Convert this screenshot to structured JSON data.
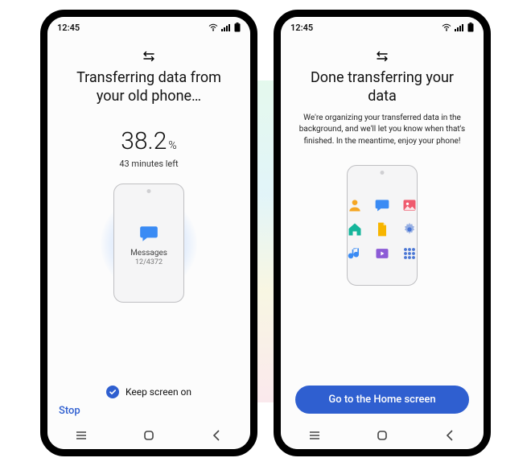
{
  "status": {
    "time": "12:45"
  },
  "left": {
    "title": "Transferring data from your old phone…",
    "progress": {
      "value": "38.2",
      "unit": "%",
      "eta": "43 minutes left"
    },
    "currentItem": {
      "icon": "message",
      "label": "Messages",
      "count": "12/4372"
    },
    "keepScreen": {
      "label": "Keep screen on",
      "checked": true
    },
    "stop": "Stop"
  },
  "right": {
    "title": "Done transferring your data",
    "subtext": "We're organizing your transferred data in the background, and we'll let you know when that's finished. In the meantime, enjoy your phone!",
    "cta": "Go to the Home screen",
    "apps": [
      "contacts",
      "messages",
      "gallery",
      "home",
      "files",
      "settings",
      "music",
      "video",
      "apps"
    ]
  }
}
